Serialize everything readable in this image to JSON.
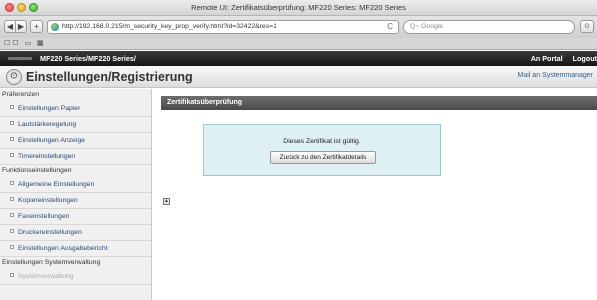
{
  "window": {
    "title": "Remote UI: Zertifikatsüberprüfung: MF220 Series: MF220 Series"
  },
  "toolbar": {
    "back_glyph": "◀",
    "forward_glyph": "▶",
    "add_glyph": "+",
    "url": "http://192.168.0.215/m_security_key_prop_verify.html?id=32422&res=1",
    "reload_glyph": "C",
    "search_placeholder": "Q~ Google",
    "download_glyph": "⊙"
  },
  "bookmarks": {
    "icons_text": "☐☐ ▭ ▦"
  },
  "site_header": {
    "product": "MF220 Series/MF220 Series/",
    "links": [
      "An Portal",
      "Logout"
    ]
  },
  "page": {
    "title": "Einstellungen/Registrierung",
    "mail_link": "Mail an Systemmanager"
  },
  "sidebar": {
    "sections": [
      {
        "label": "Präferenzen",
        "items": [
          "Einstellungen Papier",
          "Lautstärkeregelung",
          "Einstellungen Anzeige",
          "Timereinstellungen"
        ]
      },
      {
        "label": "Funktionseinstellungen",
        "items": [
          "Allgemeine Einstellungen",
          "Kopiereinstellungen",
          "Faxeinstellungen",
          "Druckereinstellungen",
          "Einstellungen Ausgabebericht"
        ]
      },
      {
        "label": "Einstellungen Systemverwaltung",
        "items": [
          "Systemverwaltung"
        ]
      }
    ]
  },
  "main": {
    "section_title": "Zertifikatsüberprüfung",
    "message": "Dieses Zertifikat ist gültig.",
    "back_button": "Zurück zu den Zertifikatdetails",
    "top_glyph": "▲"
  },
  "colors": {
    "message_bg": "#dff0f3",
    "section_bar": "#5a5a5a",
    "header_bar": "#1c1c1c"
  }
}
